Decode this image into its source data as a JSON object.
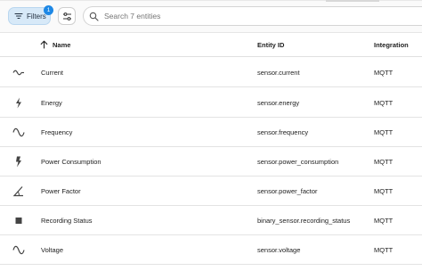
{
  "toolbar": {
    "filters_label": "Filters",
    "filters_count": "1",
    "search_placeholder": "Search 7 entities"
  },
  "table": {
    "columns": {
      "name": "Name",
      "entity_id": "Entity ID",
      "integration": "Integration"
    },
    "rows": [
      {
        "icon": "current-icon",
        "name": "Current",
        "entity_id": "sensor.current",
        "integration": "MQTT"
      },
      {
        "icon": "lightning-bolt-icon",
        "name": "Energy",
        "entity_id": "sensor.energy",
        "integration": "MQTT"
      },
      {
        "icon": "sine-wave-icon",
        "name": "Frequency",
        "entity_id": "sensor.frequency",
        "integration": "MQTT"
      },
      {
        "icon": "flash-icon",
        "name": "Power Consumption",
        "entity_id": "sensor.power_consumption",
        "integration": "MQTT"
      },
      {
        "icon": "angle-icon",
        "name": "Power Factor",
        "entity_id": "sensor.power_factor",
        "integration": "MQTT"
      },
      {
        "icon": "square-icon",
        "name": "Recording Status",
        "entity_id": "binary_sensor.recording_status",
        "integration": "MQTT"
      },
      {
        "icon": "sine-wave-icon",
        "name": "Voltage",
        "entity_id": "sensor.voltage",
        "integration": "MQTT"
      }
    ]
  }
}
